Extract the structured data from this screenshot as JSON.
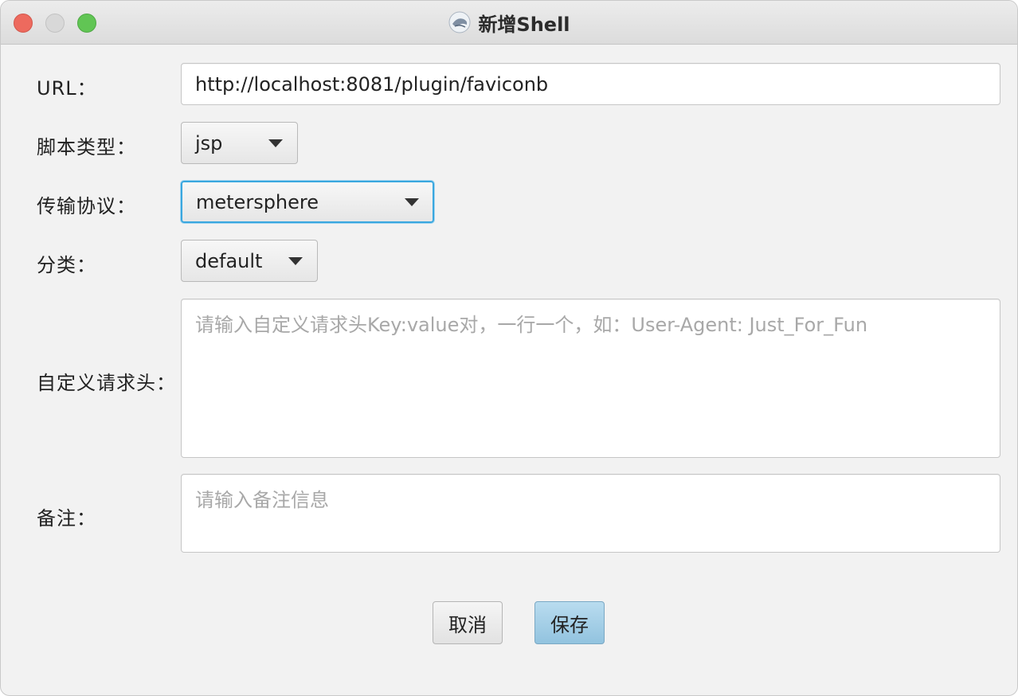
{
  "window": {
    "title": "新增Shell",
    "controls": {
      "close": "close-icon",
      "minimize": "minimize-icon",
      "maximize": "maximize-icon"
    }
  },
  "form": {
    "url": {
      "label": "URL：",
      "value": "http://localhost:8081/plugin/faviconb"
    },
    "script_type": {
      "label": "脚本类型：",
      "selected": "jsp"
    },
    "protocol": {
      "label": "传输协议：",
      "selected": "metersphere"
    },
    "category": {
      "label": "分类：",
      "selected": "default"
    },
    "headers": {
      "label": "自定义请求头：",
      "placeholder": "请输入自定义请求头Key:value对，一行一个，如：User-Agent: Just_For_Fun"
    },
    "notes": {
      "label": "备注：",
      "placeholder": "请输入备注信息"
    }
  },
  "buttons": {
    "cancel": "取消",
    "save": "保存"
  },
  "colors": {
    "focus": "#3aa7df",
    "primary_button": "#a6d0e8"
  }
}
